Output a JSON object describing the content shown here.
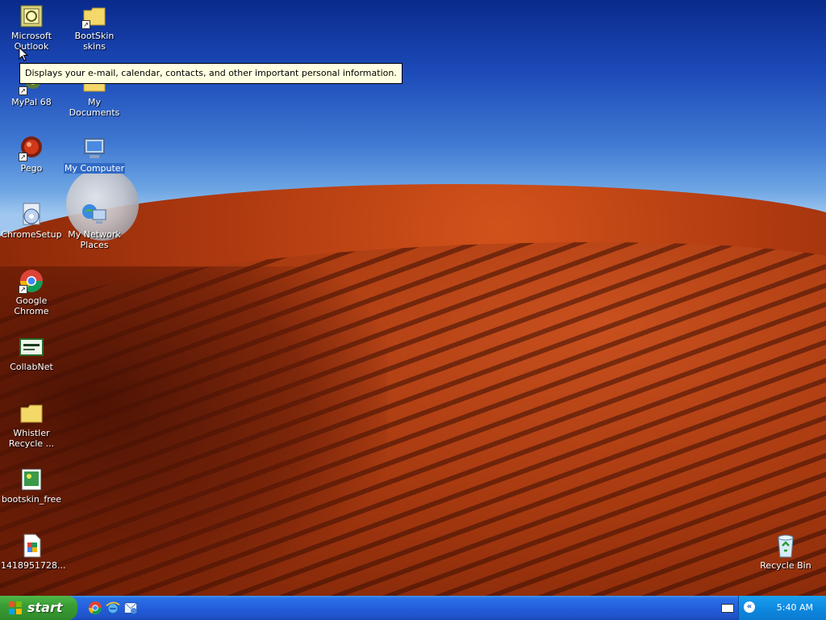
{
  "tooltip": "Displays your e-mail, calendar, contacts, and other important personal information.",
  "desktop_icons": [
    {
      "label": "Microsoft Outlook",
      "icon": "outlook-icon"
    },
    {
      "label": "BootSkin skins",
      "icon": "folder-icon"
    },
    {
      "label": "MyPal 68",
      "icon": "mypal-icon"
    },
    {
      "label": "My Documents",
      "icon": "folder-icon"
    },
    {
      "label": "Pego",
      "icon": "pego-icon"
    },
    {
      "label": "My Computer",
      "icon": "computer-icon"
    },
    {
      "label": "ChromeSetup",
      "icon": "setup-icon"
    },
    {
      "label": "My Network Places",
      "icon": "network-icon"
    },
    {
      "label": "Google Chrome",
      "icon": "chrome-icon"
    },
    {
      "label": "CollabNet",
      "icon": "collabnet-icon"
    },
    {
      "label": "Whistler Recycle ...",
      "icon": "folder-icon"
    },
    {
      "label": "bootskin_free",
      "icon": "image-icon"
    },
    {
      "label": "1418951728...",
      "icon": "file-icon"
    },
    {
      "label": "Recycle Bin",
      "icon": "recycle-bin-icon"
    }
  ],
  "taskbar": {
    "start_label": "start",
    "quick_launch": [
      "chrome-icon",
      "internet-explorer-icon",
      "outlook-express-icon"
    ],
    "clock": "5:40 AM"
  }
}
